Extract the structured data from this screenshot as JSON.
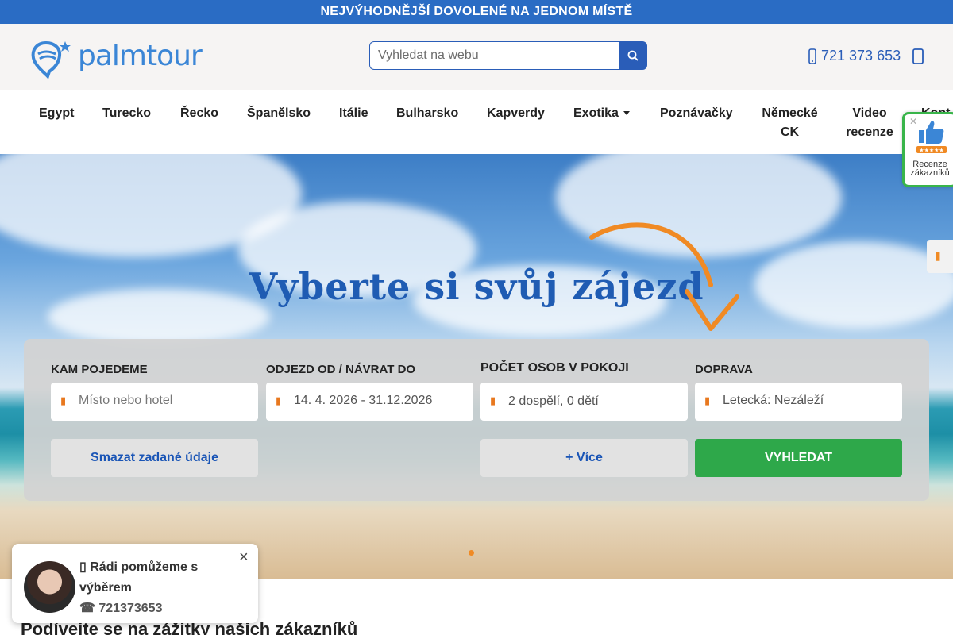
{
  "banner": {
    "text": "NEJVÝHODNĚJŠÍ DOVOLENÉ NA JEDNOM MÍSTĚ"
  },
  "header": {
    "logo_text": "palmtour",
    "search_placeholder": "Vyhledat na webu",
    "phone": "721 373 653"
  },
  "nav": {
    "items": [
      {
        "label": "Egypt"
      },
      {
        "label": "Turecko"
      },
      {
        "label": "Řecko"
      },
      {
        "label": "Španělsko"
      },
      {
        "label": "Itálie"
      },
      {
        "label": "Bulharsko"
      },
      {
        "label": "Kapverdy"
      },
      {
        "label": "Exotika"
      },
      {
        "label": "Poznávačky"
      },
      {
        "label_line1": "Německé",
        "label_line2": "CK"
      },
      {
        "label_line1": "Video",
        "label_line2": "recenze"
      },
      {
        "label": "Kont"
      }
    ]
  },
  "reviews_widget": {
    "label_line1": "Recenze",
    "label_line2": "zákazníků"
  },
  "hero": {
    "title": "Vyberte si svůj zájezd"
  },
  "search_form": {
    "destination": {
      "label": "KAM POJEDEME",
      "placeholder": "Místo nebo hotel"
    },
    "dates": {
      "label": "ODJEZD OD / NÁVRAT DO",
      "value": "14. 4. 2026 - 31.12.2026"
    },
    "persons": {
      "label": "POČET OSOB V POKOJI",
      "value": "2 dospělí, 0 dětí"
    },
    "transport": {
      "label": "DOPRAVA",
      "value": "Letecká: Nezáleží"
    },
    "clear_label": "Smazat zadané údaje",
    "more_label": "+ Více",
    "search_label": "VYHLEDAT"
  },
  "chat": {
    "message_line1": "Rádi pomůžeme s",
    "message_line2": "výběrem",
    "phone": "721373653",
    "close": "×"
  },
  "section": {
    "heading": "Podívejte se na zážitky našich zákazníků"
  },
  "colors": {
    "banner": "#2a6cc4",
    "primary": "#2a5db8",
    "accent_orange": "#f08a24",
    "search_green": "#2ea84a"
  }
}
